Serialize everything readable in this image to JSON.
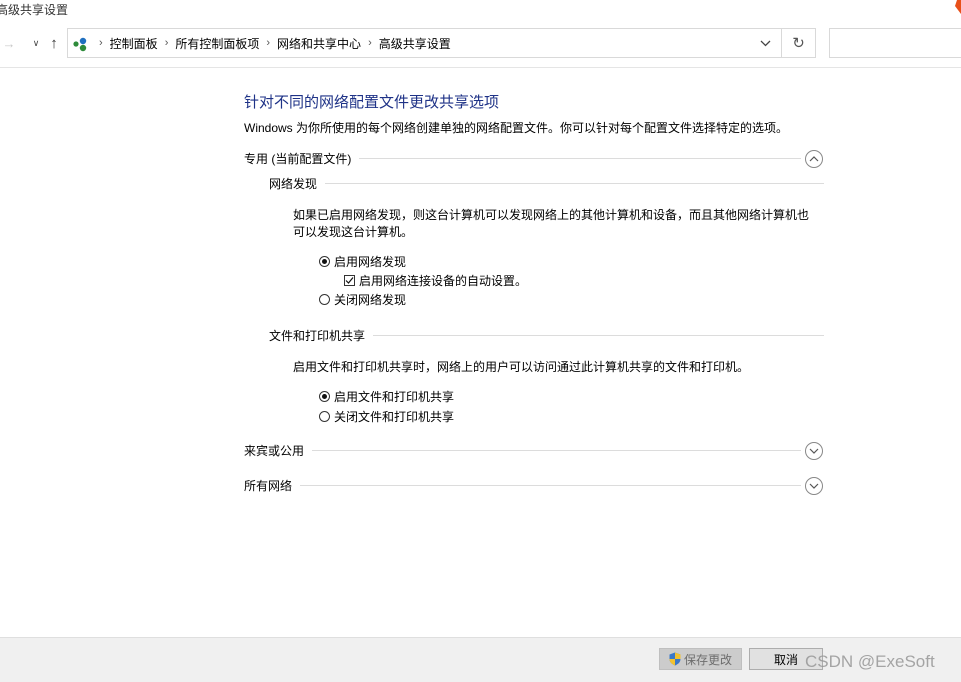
{
  "window": {
    "title": "高级共享设置"
  },
  "nav": {
    "back_icon": "arrow-left-icon",
    "recent_icon": "chevron-down-icon",
    "up_icon": "arrow-up-icon",
    "address_icon": "network-icon",
    "breadcrumbs": [
      "控制面板",
      "所有控制面板项",
      "网络和共享中心",
      "高级共享设置"
    ],
    "refresh_icon": "refresh-icon",
    "search_placeholder": ""
  },
  "page": {
    "title": "针对不同的网络配置文件更改共享选项",
    "description": "Windows 为你所使用的每个网络创建单独的网络配置文件。你可以针对每个配置文件选择特定的选项。"
  },
  "profiles": {
    "private": {
      "label": "专用 (当前配置文件)",
      "expanded": true,
      "network_discovery": {
        "heading": "网络发现",
        "description": "如果已启用网络发现，则这台计算机可以发现网络上的其他计算机和设备，而且其他网络计算机也可以发现这台计算机。",
        "option_on": "启用网络发现",
        "option_auto": "启用网络连接设备的自动设置。",
        "option_off": "关闭网络发现",
        "selected": "on",
        "auto_checked": true
      },
      "file_sharing": {
        "heading": "文件和打印机共享",
        "description": "启用文件和打印机共享时，网络上的用户可以访问通过此计算机共享的文件和打印机。",
        "option_on": "启用文件和打印机共享",
        "option_off": "关闭文件和打印机共享",
        "selected": "on"
      }
    },
    "guest": {
      "label": "来宾或公用",
      "expanded": false
    },
    "all": {
      "label": "所有网络",
      "expanded": false
    }
  },
  "footer": {
    "save_label": "保存更改",
    "cancel_label": "取消",
    "watermark": "CSDN @ExeSoft"
  },
  "colors": {
    "title": "#1e3287",
    "accent": "#0078d7"
  }
}
